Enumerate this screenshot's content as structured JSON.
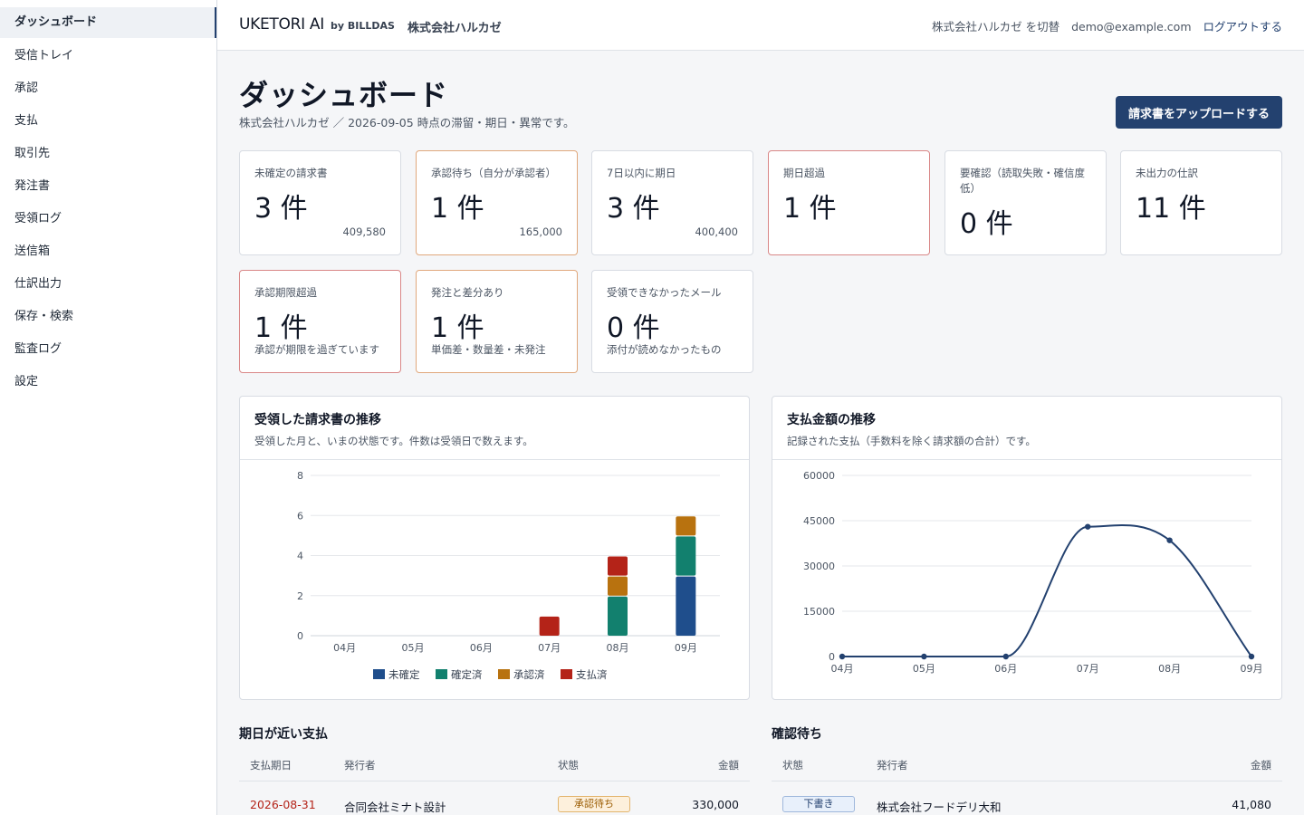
{
  "sidebar": {
    "items": [
      {
        "label": "ダッシュボード"
      },
      {
        "label": "受信トレイ"
      },
      {
        "label": "承認"
      },
      {
        "label": "支払"
      },
      {
        "label": "取引先"
      },
      {
        "label": "発注書"
      },
      {
        "label": "受領ログ"
      },
      {
        "label": "送信箱"
      },
      {
        "label": "仕訳出力"
      },
      {
        "label": "保存・検索"
      },
      {
        "label": "監査ログ"
      },
      {
        "label": "設定"
      }
    ]
  },
  "header": {
    "brand": "UKETORI AI",
    "brand_sub": "by BILLDAS",
    "company": "株式会社ハルカゼ",
    "switch_label": "株式会社ハルカゼ を切替",
    "email": "demo@example.com",
    "logout": "ログアウトする"
  },
  "page": {
    "title": "ダッシュボード",
    "subtitle": "株式会社ハルカゼ ／ 2026-09-05 時点の滞留・期日・異常です。",
    "upload_button": "請求書をアップロードする"
  },
  "stats": [
    {
      "label": "未確定の請求書",
      "value": "3 件",
      "amount": "409,580"
    },
    {
      "label": "承認待ち（自分が承認者）",
      "value": "1 件",
      "amount": "165,000"
    },
    {
      "label": "7日以内に期日",
      "value": "3 件",
      "amount": "400,400"
    },
    {
      "label": "期日超過",
      "value": "1 件"
    },
    {
      "label": "要確認（読取失敗・確信度低）",
      "value": "0 件"
    },
    {
      "label": "未出力の仕訳",
      "value": "11 件"
    },
    {
      "label": "承認期限超過",
      "value": "1 件",
      "note": "承認が期限を過ぎています"
    },
    {
      "label": "発注と差分あり",
      "value": "1 件",
      "note": "単価差・数量差・未発注"
    },
    {
      "label": "受領できなかったメール",
      "value": "0 件",
      "note": "添付が読めなかったもの"
    }
  ],
  "panels": {
    "received": {
      "title": "受領した請求書の推移",
      "subtitle": "受領した月と、いまの状態です。件数は受領日で数えます。"
    },
    "payments": {
      "title": "支払金額の推移",
      "subtitle": "記録された支払（手数料を除く請求額の合計）です。"
    }
  },
  "chart_data": [
    {
      "type": "bar",
      "stacked": true,
      "categories": [
        "04月",
        "05月",
        "06月",
        "07月",
        "08月",
        "09月"
      ],
      "series": [
        {
          "name": "未確定",
          "color": "#1f4e8c",
          "values": [
            0,
            0,
            0,
            0,
            0,
            3
          ]
        },
        {
          "name": "確定済",
          "color": "#12806e",
          "values": [
            0,
            0,
            0,
            0,
            2,
            2
          ]
        },
        {
          "name": "承認済",
          "color": "#b8720f",
          "values": [
            0,
            0,
            0,
            0,
            1,
            1
          ]
        },
        {
          "name": "支払済",
          "color": "#b42318",
          "values": [
            0,
            0,
            0,
            1,
            1,
            0
          ]
        }
      ],
      "yticks": [
        0,
        2,
        4,
        6,
        8
      ],
      "ylim": [
        0,
        8
      ],
      "grid": true,
      "legend": "bottom"
    },
    {
      "type": "line",
      "smooth": true,
      "x": [
        "04月",
        "05月",
        "06月",
        "07月",
        "08月",
        "09月"
      ],
      "series": [
        {
          "color": "#23416f",
          "values": [
            0,
            0,
            0,
            43000,
            38500,
            0
          ]
        }
      ],
      "yticks": [
        0,
        15000,
        30000,
        45000,
        60000
      ],
      "ylim": [
        0,
        60000
      ],
      "grid": true
    }
  ],
  "due_table": {
    "title": "期日が近い支払",
    "headers": [
      "支払期日",
      "発行者",
      "状態",
      "金額"
    ],
    "rows": [
      {
        "due": "2026-08-31",
        "issuer": "合同会社ミナト設計",
        "status": "承認待ち",
        "amount": "330,000"
      }
    ]
  },
  "pending_table": {
    "title": "確認待ち",
    "headers": [
      "状態",
      "発行者",
      "金額"
    ],
    "rows": [
      {
        "status": "下書き",
        "issuer": "株式会社フードデリ大和",
        "amount": "41,080"
      }
    ]
  }
}
